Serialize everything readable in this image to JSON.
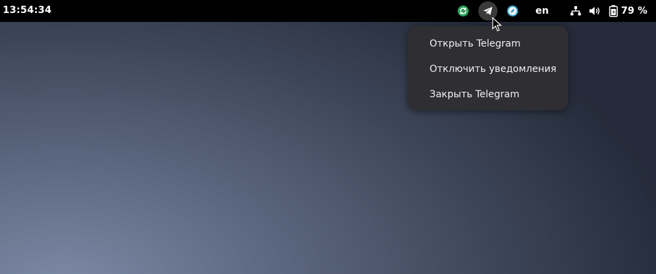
{
  "topbar": {
    "clock": "13:54:34",
    "tray": [
      {
        "icon": "sync-icon",
        "color": "#2ca05a"
      },
      {
        "icon": "telegram-icon",
        "color": "#ffffff",
        "active": true
      },
      {
        "icon": "compass-icon",
        "color": "#3aa6d0"
      }
    ],
    "keyboard_layout": "en",
    "network_icon": "network-wired-icon",
    "volume_icon": "volume-icon",
    "battery_icon": "battery-charging-icon",
    "battery_percent": "79 %"
  },
  "context_menu": {
    "items": [
      {
        "label": "Открыть Telegram"
      },
      {
        "label": "Отключить уведомления"
      },
      {
        "label": "Закрыть Telegram"
      }
    ]
  }
}
